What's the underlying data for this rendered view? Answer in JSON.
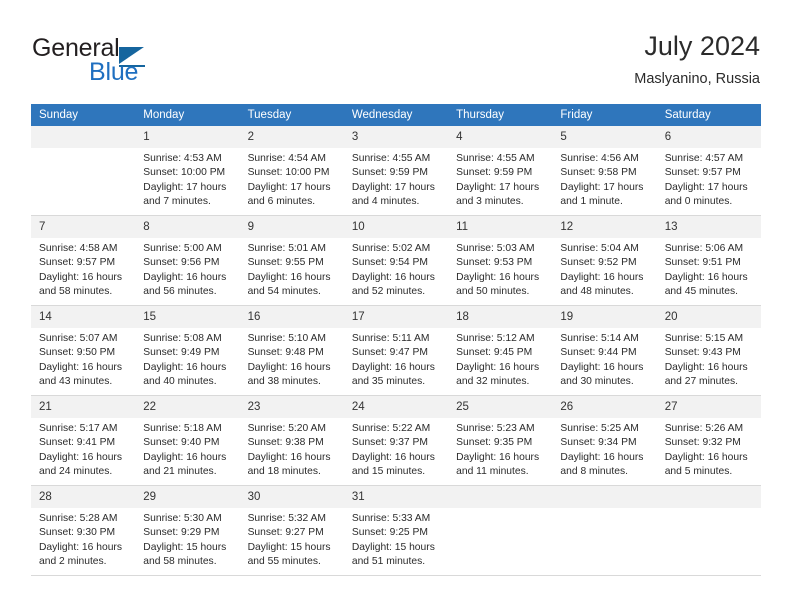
{
  "brand": {
    "name_part1": "General",
    "name_part2": "Blue",
    "accent_color": "#15659e",
    "logo_icon": "triangle-right-icon"
  },
  "header": {
    "title": "July 2024",
    "subtitle": "Maslyanino, Russia"
  },
  "calendar": {
    "header_bg": "#2f76bc",
    "daynum_bg": "#f2f2f2",
    "weekday_headers": [
      "Sunday",
      "Monday",
      "Tuesday",
      "Wednesday",
      "Thursday",
      "Friday",
      "Saturday"
    ],
    "weeks": [
      [
        {
          "day": "",
          "empty": true,
          "sunrise": "",
          "sunset": "",
          "daylight1": "",
          "daylight2": ""
        },
        {
          "day": "1",
          "sunrise": "Sunrise: 4:53 AM",
          "sunset": "Sunset: 10:00 PM",
          "daylight1": "Daylight: 17 hours",
          "daylight2": "and 7 minutes."
        },
        {
          "day": "2",
          "sunrise": "Sunrise: 4:54 AM",
          "sunset": "Sunset: 10:00 PM",
          "daylight1": "Daylight: 17 hours",
          "daylight2": "and 6 minutes."
        },
        {
          "day": "3",
          "sunrise": "Sunrise: 4:55 AM",
          "sunset": "Sunset: 9:59 PM",
          "daylight1": "Daylight: 17 hours",
          "daylight2": "and 4 minutes."
        },
        {
          "day": "4",
          "sunrise": "Sunrise: 4:55 AM",
          "sunset": "Sunset: 9:59 PM",
          "daylight1": "Daylight: 17 hours",
          "daylight2": "and 3 minutes."
        },
        {
          "day": "5",
          "sunrise": "Sunrise: 4:56 AM",
          "sunset": "Sunset: 9:58 PM",
          "daylight1": "Daylight: 17 hours",
          "daylight2": "and 1 minute."
        },
        {
          "day": "6",
          "sunrise": "Sunrise: 4:57 AM",
          "sunset": "Sunset: 9:57 PM",
          "daylight1": "Daylight: 17 hours",
          "daylight2": "and 0 minutes."
        }
      ],
      [
        {
          "day": "7",
          "sunrise": "Sunrise: 4:58 AM",
          "sunset": "Sunset: 9:57 PM",
          "daylight1": "Daylight: 16 hours",
          "daylight2": "and 58 minutes."
        },
        {
          "day": "8",
          "sunrise": "Sunrise: 5:00 AM",
          "sunset": "Sunset: 9:56 PM",
          "daylight1": "Daylight: 16 hours",
          "daylight2": "and 56 minutes."
        },
        {
          "day": "9",
          "sunrise": "Sunrise: 5:01 AM",
          "sunset": "Sunset: 9:55 PM",
          "daylight1": "Daylight: 16 hours",
          "daylight2": "and 54 minutes."
        },
        {
          "day": "10",
          "sunrise": "Sunrise: 5:02 AM",
          "sunset": "Sunset: 9:54 PM",
          "daylight1": "Daylight: 16 hours",
          "daylight2": "and 52 minutes."
        },
        {
          "day": "11",
          "sunrise": "Sunrise: 5:03 AM",
          "sunset": "Sunset: 9:53 PM",
          "daylight1": "Daylight: 16 hours",
          "daylight2": "and 50 minutes."
        },
        {
          "day": "12",
          "sunrise": "Sunrise: 5:04 AM",
          "sunset": "Sunset: 9:52 PM",
          "daylight1": "Daylight: 16 hours",
          "daylight2": "and 48 minutes."
        },
        {
          "day": "13",
          "sunrise": "Sunrise: 5:06 AM",
          "sunset": "Sunset: 9:51 PM",
          "daylight1": "Daylight: 16 hours",
          "daylight2": "and 45 minutes."
        }
      ],
      [
        {
          "day": "14",
          "sunrise": "Sunrise: 5:07 AM",
          "sunset": "Sunset: 9:50 PM",
          "daylight1": "Daylight: 16 hours",
          "daylight2": "and 43 minutes."
        },
        {
          "day": "15",
          "sunrise": "Sunrise: 5:08 AM",
          "sunset": "Sunset: 9:49 PM",
          "daylight1": "Daylight: 16 hours",
          "daylight2": "and 40 minutes."
        },
        {
          "day": "16",
          "sunrise": "Sunrise: 5:10 AM",
          "sunset": "Sunset: 9:48 PM",
          "daylight1": "Daylight: 16 hours",
          "daylight2": "and 38 minutes."
        },
        {
          "day": "17",
          "sunrise": "Sunrise: 5:11 AM",
          "sunset": "Sunset: 9:47 PM",
          "daylight1": "Daylight: 16 hours",
          "daylight2": "and 35 minutes."
        },
        {
          "day": "18",
          "sunrise": "Sunrise: 5:12 AM",
          "sunset": "Sunset: 9:45 PM",
          "daylight1": "Daylight: 16 hours",
          "daylight2": "and 32 minutes."
        },
        {
          "day": "19",
          "sunrise": "Sunrise: 5:14 AM",
          "sunset": "Sunset: 9:44 PM",
          "daylight1": "Daylight: 16 hours",
          "daylight2": "and 30 minutes."
        },
        {
          "day": "20",
          "sunrise": "Sunrise: 5:15 AM",
          "sunset": "Sunset: 9:43 PM",
          "daylight1": "Daylight: 16 hours",
          "daylight2": "and 27 minutes."
        }
      ],
      [
        {
          "day": "21",
          "sunrise": "Sunrise: 5:17 AM",
          "sunset": "Sunset: 9:41 PM",
          "daylight1": "Daylight: 16 hours",
          "daylight2": "and 24 minutes."
        },
        {
          "day": "22",
          "sunrise": "Sunrise: 5:18 AM",
          "sunset": "Sunset: 9:40 PM",
          "daylight1": "Daylight: 16 hours",
          "daylight2": "and 21 minutes."
        },
        {
          "day": "23",
          "sunrise": "Sunrise: 5:20 AM",
          "sunset": "Sunset: 9:38 PM",
          "daylight1": "Daylight: 16 hours",
          "daylight2": "and 18 minutes."
        },
        {
          "day": "24",
          "sunrise": "Sunrise: 5:22 AM",
          "sunset": "Sunset: 9:37 PM",
          "daylight1": "Daylight: 16 hours",
          "daylight2": "and 15 minutes."
        },
        {
          "day": "25",
          "sunrise": "Sunrise: 5:23 AM",
          "sunset": "Sunset: 9:35 PM",
          "daylight1": "Daylight: 16 hours",
          "daylight2": "and 11 minutes."
        },
        {
          "day": "26",
          "sunrise": "Sunrise: 5:25 AM",
          "sunset": "Sunset: 9:34 PM",
          "daylight1": "Daylight: 16 hours",
          "daylight2": "and 8 minutes."
        },
        {
          "day": "27",
          "sunrise": "Sunrise: 5:26 AM",
          "sunset": "Sunset: 9:32 PM",
          "daylight1": "Daylight: 16 hours",
          "daylight2": "and 5 minutes."
        }
      ],
      [
        {
          "day": "28",
          "sunrise": "Sunrise: 5:28 AM",
          "sunset": "Sunset: 9:30 PM",
          "daylight1": "Daylight: 16 hours",
          "daylight2": "and 2 minutes."
        },
        {
          "day": "29",
          "sunrise": "Sunrise: 5:30 AM",
          "sunset": "Sunset: 9:29 PM",
          "daylight1": "Daylight: 15 hours",
          "daylight2": "and 58 minutes."
        },
        {
          "day": "30",
          "sunrise": "Sunrise: 5:32 AM",
          "sunset": "Sunset: 9:27 PM",
          "daylight1": "Daylight: 15 hours",
          "daylight2": "and 55 minutes."
        },
        {
          "day": "31",
          "sunrise": "Sunrise: 5:33 AM",
          "sunset": "Sunset: 9:25 PM",
          "daylight1": "Daylight: 15 hours",
          "daylight2": "and 51 minutes."
        },
        {
          "day": "",
          "empty": true,
          "sunrise": "",
          "sunset": "",
          "daylight1": "",
          "daylight2": ""
        },
        {
          "day": "",
          "empty": true,
          "sunrise": "",
          "sunset": "",
          "daylight1": "",
          "daylight2": ""
        },
        {
          "day": "",
          "empty": true,
          "sunrise": "",
          "sunset": "",
          "daylight1": "",
          "daylight2": ""
        }
      ]
    ]
  }
}
